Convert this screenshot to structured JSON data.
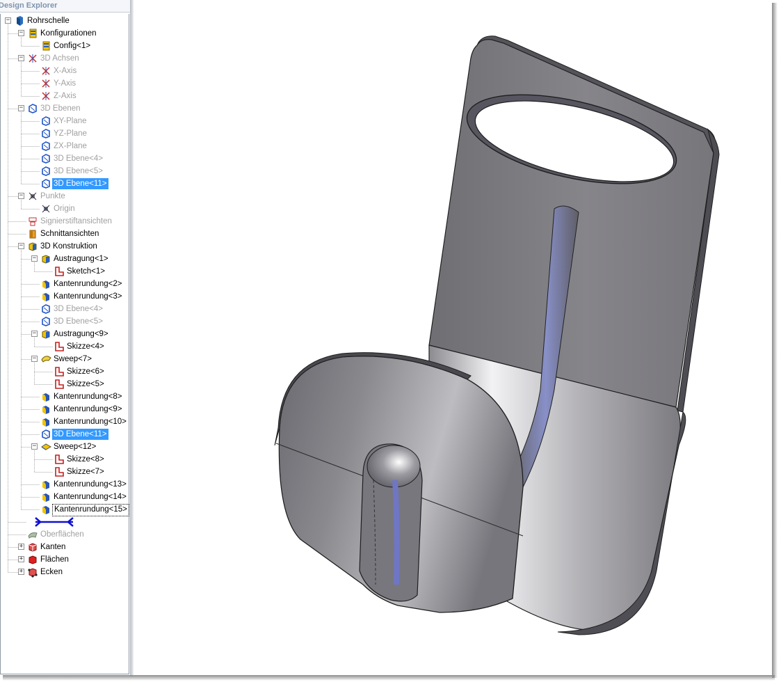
{
  "panel": {
    "title": "Design Explorer"
  },
  "tree": [
    {
      "label": "Rohrschelle",
      "level": 0,
      "icon": "part-icon",
      "exp": "minus",
      "state": "normal"
    },
    {
      "label": "Konfigurationen",
      "level": 1,
      "icon": "config-icon",
      "exp": "minus",
      "state": "normal"
    },
    {
      "label": "Config<1>",
      "level": 2,
      "icon": "config-icon",
      "exp": "",
      "state": "normal"
    },
    {
      "label": "3D Achsen",
      "level": 1,
      "icon": "axis-icon",
      "exp": "minus",
      "state": "grey"
    },
    {
      "label": "X-Axis",
      "level": 2,
      "icon": "axis-icon",
      "exp": "",
      "state": "grey"
    },
    {
      "label": "Y-Axis",
      "level": 2,
      "icon": "axis-icon",
      "exp": "",
      "state": "grey"
    },
    {
      "label": "Z-Axis",
      "level": 2,
      "icon": "axis-icon",
      "exp": "",
      "state": "grey"
    },
    {
      "label": "3D Ebenen",
      "level": 1,
      "icon": "plane-icon",
      "exp": "minus",
      "state": "grey"
    },
    {
      "label": "XY-Plane",
      "level": 2,
      "icon": "plane-icon",
      "exp": "",
      "state": "grey"
    },
    {
      "label": "YZ-Plane",
      "level": 2,
      "icon": "plane-icon",
      "exp": "",
      "state": "grey"
    },
    {
      "label": "ZX-Plane",
      "level": 2,
      "icon": "plane-icon",
      "exp": "",
      "state": "grey"
    },
    {
      "label": "3D Ebene<4>",
      "level": 2,
      "icon": "plane-icon",
      "exp": "",
      "state": "grey"
    },
    {
      "label": "3D Ebene<5>",
      "level": 2,
      "icon": "plane-icon",
      "exp": "",
      "state": "grey"
    },
    {
      "label": "3D Ebene<11>",
      "level": 2,
      "icon": "plane-icon",
      "exp": "",
      "state": "sel"
    },
    {
      "label": "Punkte",
      "level": 1,
      "icon": "point-icon",
      "exp": "minus",
      "state": "grey"
    },
    {
      "label": "Origin",
      "level": 2,
      "icon": "point-icon",
      "exp": "",
      "state": "grey"
    },
    {
      "label": "Signierstiftansichten",
      "level": 1,
      "icon": "marker-icon",
      "exp": "",
      "state": "grey"
    },
    {
      "label": "Schnittansichten",
      "level": 1,
      "icon": "section-icon",
      "exp": "",
      "state": "normal"
    },
    {
      "label": "3D Konstruktion",
      "level": 1,
      "icon": "feature-icon",
      "exp": "minus",
      "state": "normal"
    },
    {
      "label": "Austragung<1>",
      "level": 2,
      "icon": "extrude-icon",
      "exp": "minus",
      "state": "normal"
    },
    {
      "label": "Sketch<1>",
      "level": 3,
      "icon": "sketch-icon",
      "exp": "",
      "state": "normal"
    },
    {
      "label": "Kantenrundung<2>",
      "level": 2,
      "icon": "fillet-icon",
      "exp": "",
      "state": "normal"
    },
    {
      "label": "Kantenrundung<3>",
      "level": 2,
      "icon": "fillet-icon",
      "exp": "",
      "state": "normal"
    },
    {
      "label": "3D Ebene<4>",
      "level": 2,
      "icon": "plane-icon",
      "exp": "",
      "state": "grey"
    },
    {
      "label": "3D Ebene<5>",
      "level": 2,
      "icon": "plane-icon",
      "exp": "",
      "state": "grey"
    },
    {
      "label": "Austragung<9>",
      "level": 2,
      "icon": "extrude-icon",
      "exp": "minus",
      "state": "normal"
    },
    {
      "label": "Skizze<4>",
      "level": 3,
      "icon": "sketch-icon",
      "exp": "",
      "state": "normal"
    },
    {
      "label": "Sweep<7>",
      "level": 2,
      "icon": "sweep-icon",
      "exp": "minus",
      "state": "normal"
    },
    {
      "label": "Skizze<6>",
      "level": 3,
      "icon": "sketch-icon",
      "exp": "",
      "state": "normal"
    },
    {
      "label": "Skizze<5>",
      "level": 3,
      "icon": "sketch-icon",
      "exp": "",
      "state": "normal"
    },
    {
      "label": "Kantenrundung<8>",
      "level": 2,
      "icon": "fillet-icon",
      "exp": "",
      "state": "normal"
    },
    {
      "label": "Kantenrundung<9>",
      "level": 2,
      "icon": "fillet-icon",
      "exp": "",
      "state": "normal"
    },
    {
      "label": "Kantenrundung<10>",
      "level": 2,
      "icon": "fillet-icon",
      "exp": "",
      "state": "normal"
    },
    {
      "label": "3D Ebene<11>",
      "level": 2,
      "icon": "plane-icon",
      "exp": "",
      "state": "sel"
    },
    {
      "label": "Sweep<12>",
      "level": 2,
      "icon": "sweep2-icon",
      "exp": "minus",
      "state": "normal"
    },
    {
      "label": "Skizze<8>",
      "level": 3,
      "icon": "sketch-icon",
      "exp": "",
      "state": "normal"
    },
    {
      "label": "Skizze<7>",
      "level": 3,
      "icon": "sketch-icon",
      "exp": "",
      "state": "normal"
    },
    {
      "label": "Kantenrundung<13>",
      "level": 2,
      "icon": "fillet-icon",
      "exp": "",
      "state": "normal"
    },
    {
      "label": "Kantenrundung<14>",
      "level": 2,
      "icon": "fillet-icon",
      "exp": "",
      "state": "normal"
    },
    {
      "label": "Kantenrundung<15>",
      "level": 2,
      "icon": "fillet-icon",
      "exp": "",
      "state": "focus"
    },
    {
      "label": "",
      "level": 1,
      "icon": "rollback-bar-icon",
      "exp": "",
      "state": "normal"
    },
    {
      "label": "Oberflächen",
      "level": 1,
      "icon": "surface-icon",
      "exp": "",
      "state": "grey"
    },
    {
      "label": "Kanten",
      "level": 1,
      "icon": "edges-icon",
      "exp": "plus",
      "state": "normal"
    },
    {
      "label": "Flächen",
      "level": 1,
      "icon": "faces-icon",
      "exp": "plus",
      "state": "normal"
    },
    {
      "label": "Ecken",
      "level": 1,
      "icon": "vertices-icon",
      "exp": "plus",
      "state": "normal"
    }
  ],
  "colors": {
    "selection": "#3399ff",
    "disabled_text": "#a0a0a0",
    "title_text": "#7f93ad"
  }
}
